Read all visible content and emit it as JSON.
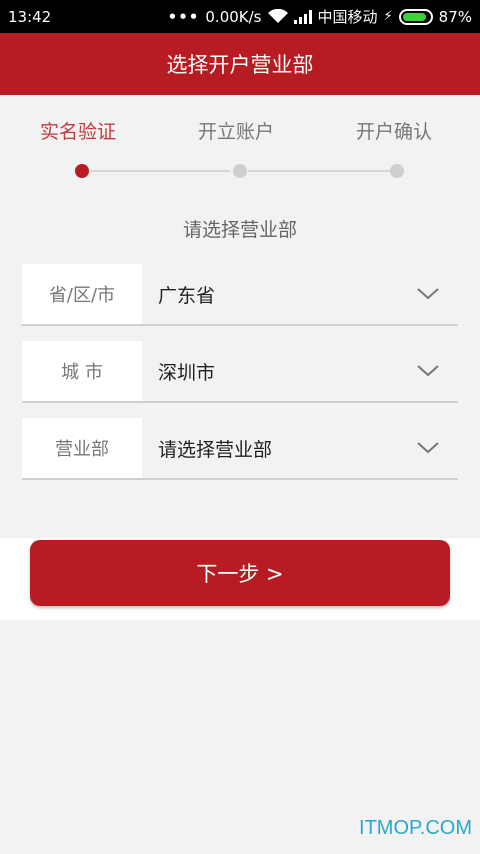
{
  "status_bar": {
    "time": "13:42",
    "speed": "0.00K/s",
    "carrier": "中国移动",
    "battery": "87%",
    "battery_level": 0.87,
    "battery_color": "#3ad33a"
  },
  "header": {
    "title": "选择开户营业部"
  },
  "colors": {
    "brand": "#b71c22",
    "active_step_text": "#c23a3f"
  },
  "steps": [
    {
      "label": "实名验证",
      "active": true
    },
    {
      "label": "开立账户",
      "active": false
    },
    {
      "label": "开户确认",
      "active": false
    }
  ],
  "form": {
    "title": "请选择营业部",
    "fields": [
      {
        "label": "省/区/市",
        "value": "广东省"
      },
      {
        "label": "城 市",
        "value": "深圳市"
      },
      {
        "label": "营业部",
        "value": "请选择营业部"
      }
    ]
  },
  "actions": {
    "next_label": "下一步 >"
  },
  "watermark": "ITMOP.COM"
}
